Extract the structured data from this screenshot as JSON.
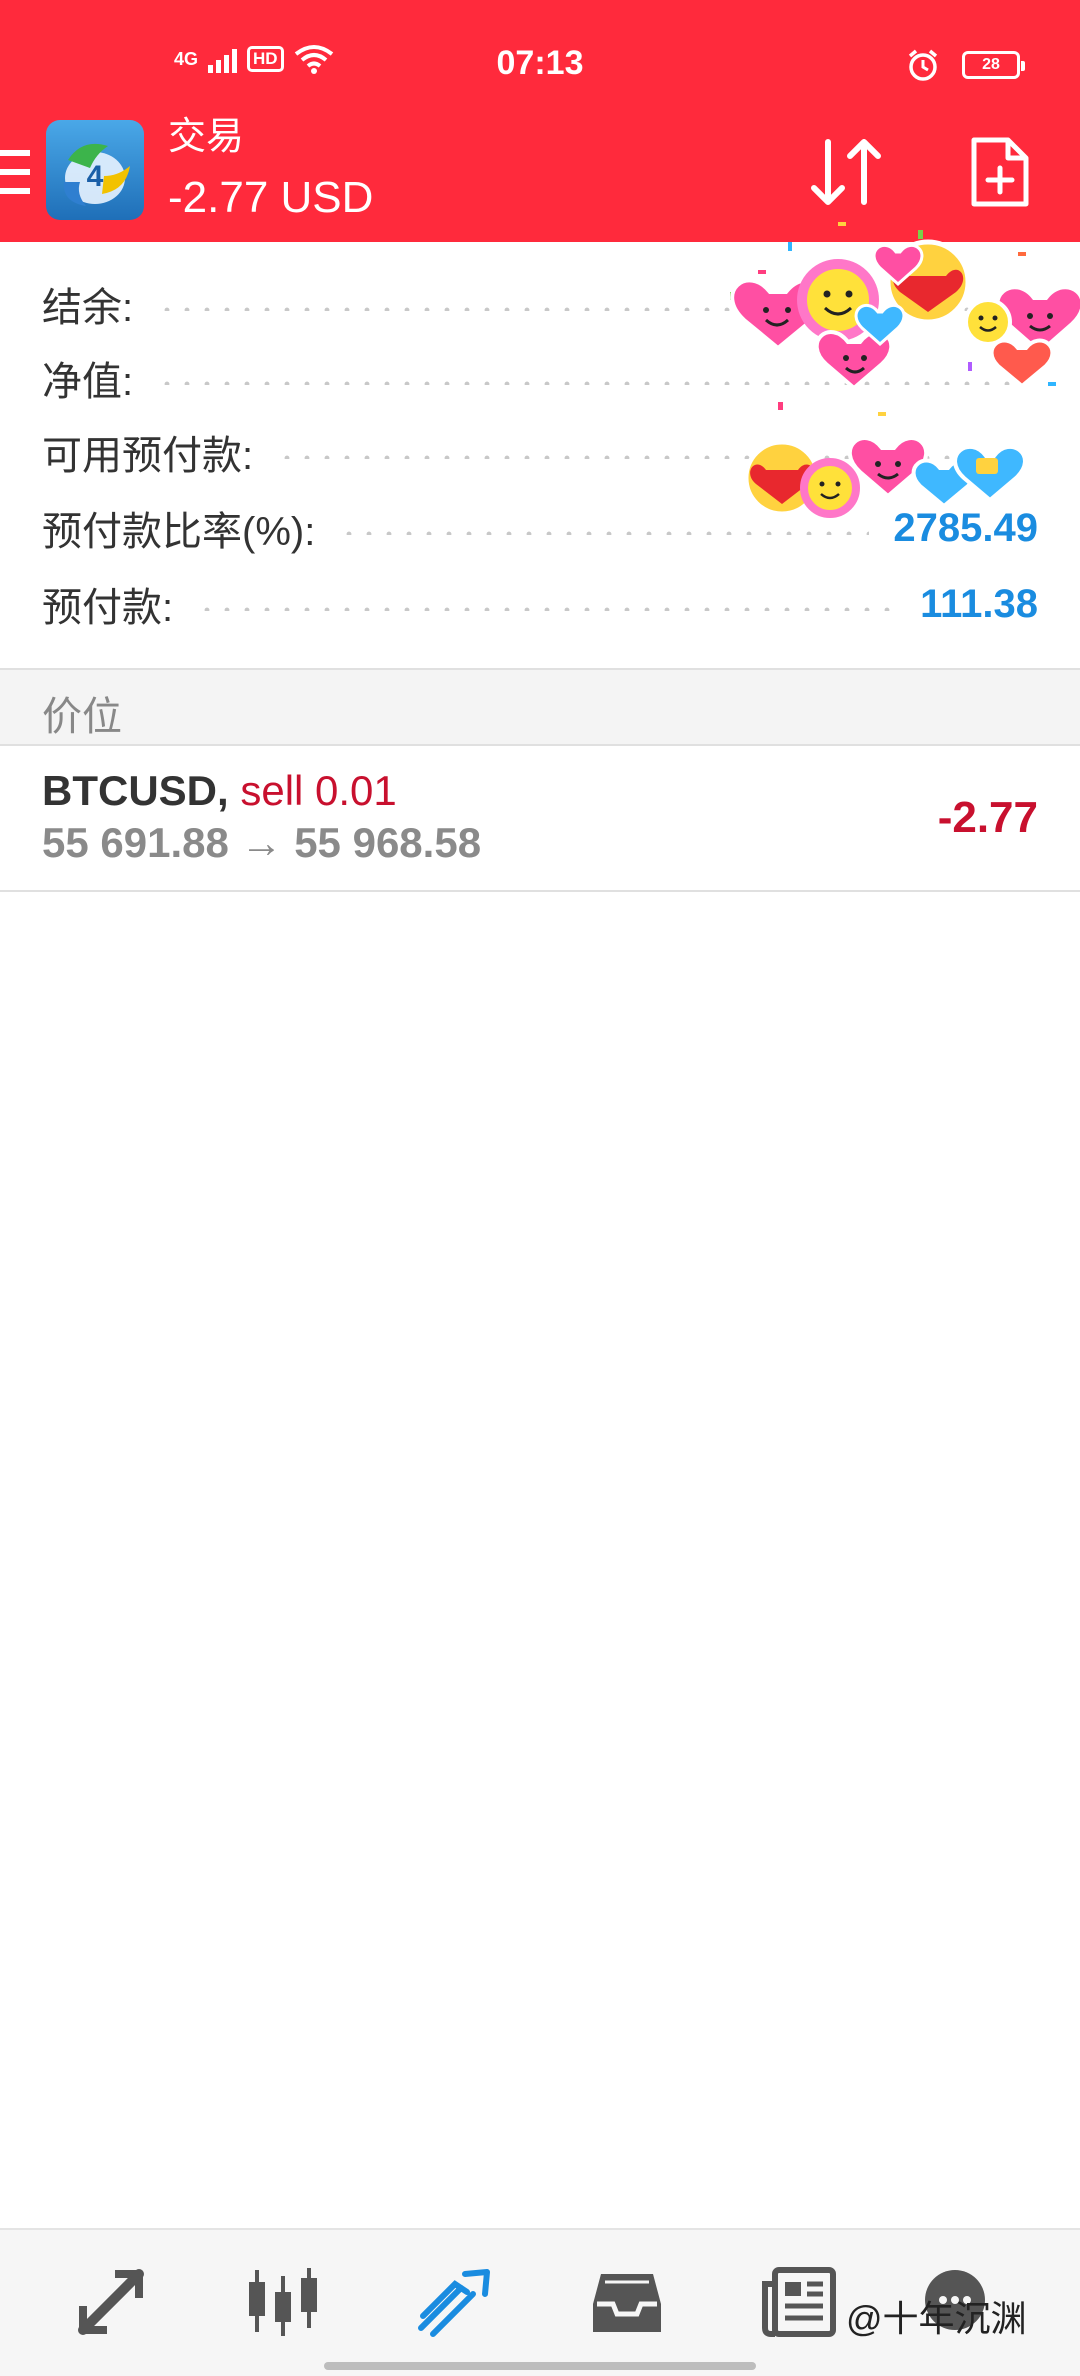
{
  "status_bar": {
    "network": "4G",
    "hd": "HD",
    "time": "07:13",
    "battery": "28"
  },
  "header": {
    "title": "交易",
    "balance": "-2.77 USD",
    "color": "#ff2a3c"
  },
  "summary": {
    "rows": [
      {
        "label": "结余:",
        "value": ""
      },
      {
        "label": "净值:",
        "value": ""
      },
      {
        "label": "可用预付款:",
        "value": ""
      },
      {
        "label": "预付款比率(%):",
        "value": "2785.49"
      },
      {
        "label": "预付款:",
        "value": "111.38"
      }
    ],
    "value_color": "#1a8ce0"
  },
  "positions": {
    "section_title": "价位",
    "items": [
      {
        "symbol": "BTCUSD,",
        "side": "sell 0.01",
        "open_price": "55 691.88",
        "arrow": "→",
        "current_price": "55 968.58",
        "profit": "-2.77"
      }
    ]
  },
  "bottom_nav": {
    "items": [
      {
        "icon": "quotes-arrows-icon",
        "active": false
      },
      {
        "icon": "chart-candles-icon",
        "active": false
      },
      {
        "icon": "trade-icon",
        "active": true
      },
      {
        "icon": "history-inbox-icon",
        "active": false
      },
      {
        "icon": "news-icon",
        "active": false
      },
      {
        "icon": "chat-icon",
        "active": false
      }
    ],
    "active_color": "#1a8ce0",
    "watermark": "@十年沉渊"
  }
}
